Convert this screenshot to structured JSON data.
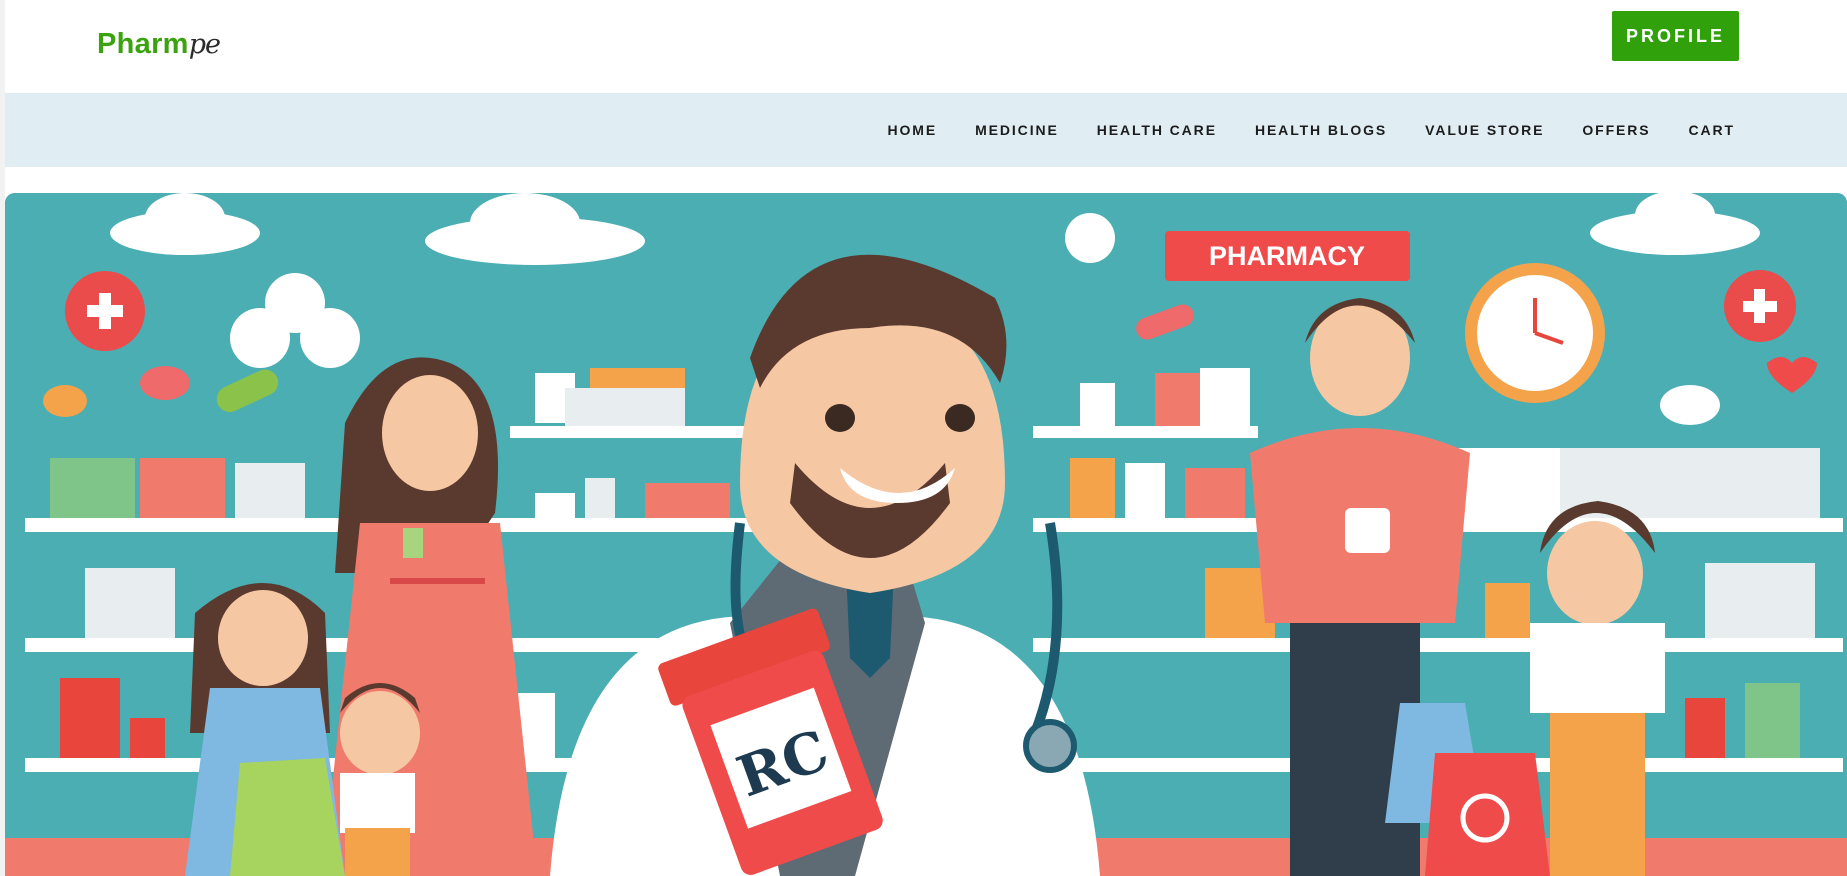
{
  "header": {
    "logo_main": "Pharm",
    "logo_tail": "pe",
    "profile_label": "PROFILE"
  },
  "nav": {
    "items": [
      {
        "label": "HOME"
      },
      {
        "label": "MEDICINE"
      },
      {
        "label": "HEALTH CARE"
      },
      {
        "label": "HEALTH BLOGS"
      },
      {
        "label": "VALUE STORE"
      },
      {
        "label": "OFFERS"
      },
      {
        "label": "CART"
      }
    ]
  },
  "hero": {
    "sign_text": "PHARMACY",
    "bottle_label": "RC"
  },
  "colors": {
    "brand_green": "#30a10b",
    "nav_bg": "#e0edf2",
    "hero_teal": "#4aaeb3"
  }
}
